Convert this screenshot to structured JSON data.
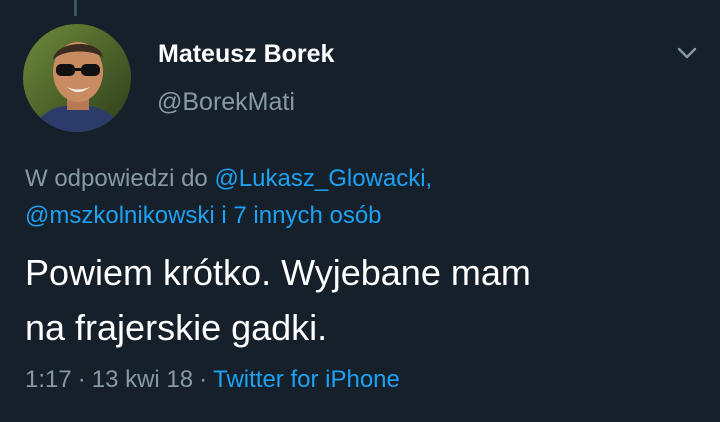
{
  "author": {
    "name": "Mateusz Borek",
    "handle": "@BorekMati"
  },
  "reply": {
    "prefix": "W odpowiedzi do",
    "mention_1": "@Lukasz_Glowacki,",
    "mention_2": "@mszkolnikowski",
    "suffix": "i 7 innych osób"
  },
  "tweet": {
    "line_1": "Powiem krótko. Wyjebane mam",
    "line_2": "na frajerskie gadki."
  },
  "meta": {
    "time": "1:17",
    "date": "13 kwi 18",
    "separator": "·",
    "source": "Twitter for iPhone"
  },
  "icons": {
    "caret": "chevron-down-icon",
    "avatar": "profile-photo"
  },
  "colors": {
    "background": "#15202b",
    "link": "#1da1f2",
    "muted": "#8899a6",
    "text": "#ffffff"
  }
}
